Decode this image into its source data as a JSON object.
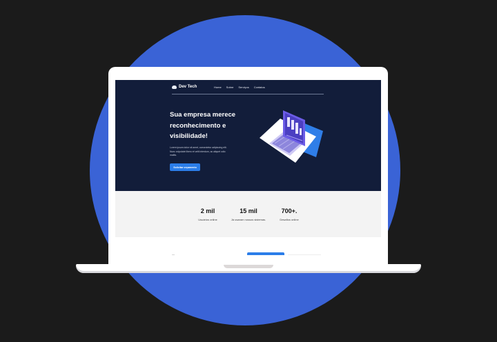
{
  "nav": {
    "logo_text": "Dev Tech",
    "links": [
      "Home",
      "Sobre",
      "Serviços",
      "Contatos"
    ]
  },
  "hero": {
    "title_lines": [
      "Sua empresa merece",
      "reconhecimento e",
      "visibilidade!"
    ],
    "description": "Lorem ipsum dolor sit amet, consectetur adipiscing elit. Nunc vulputate libero et velit interdum, ac aliquet odio mattis.",
    "cta_label": "Solicitar orçamento"
  },
  "stats": [
    {
      "value": "2 mil",
      "label": "Usuários online"
    },
    {
      "value": "15 mil",
      "label": "Já usaram nossos sistemas."
    },
    {
      "value": "700+.",
      "label": "Desafios online"
    }
  ],
  "colors": {
    "background": "#1b1b1b",
    "circle": "#3a63d6",
    "hero_bg": "#121d3a",
    "accent": "#2b7de9",
    "stats_bg": "#f3f3f3"
  },
  "icons": [
    "cloud-logo-icon",
    "laptop-chart-illustration"
  ]
}
